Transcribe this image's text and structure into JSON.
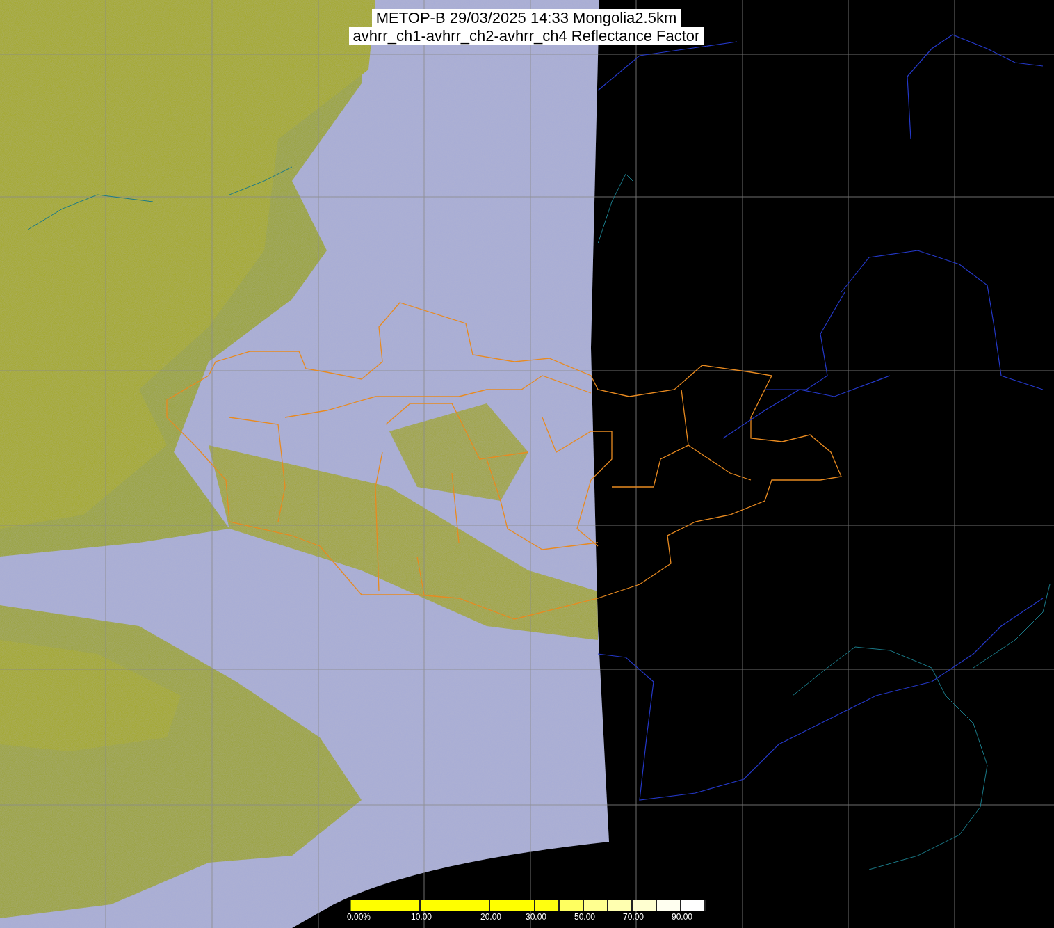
{
  "title": {
    "lines": [
      "METOP-B 29/03/2025 14:33 Mongolia2.5km",
      "avhrr_ch1-avhrr_ch2-avhrr_ch4 Reflectance Factor"
    ]
  },
  "legend": {
    "segments": [
      {
        "color": "#ffff00",
        "tick": "0.00%"
      },
      {
        "color": "#ffff00",
        "tick": "10.00"
      },
      {
        "color": "#ffff00",
        "tick": "20.00"
      },
      {
        "color": "#ffff10",
        "tick": "30.00"
      },
      {
        "color": "#ffff60"
      },
      {
        "color": "#ffff90",
        "tick": "50.00"
      },
      {
        "color": "#ffffb0"
      },
      {
        "color": "#ffffd0",
        "tick": "70.00"
      },
      {
        "color": "#fffff0"
      },
      {
        "color": "#ffffff",
        "tick": "90.00"
      }
    ]
  }
}
